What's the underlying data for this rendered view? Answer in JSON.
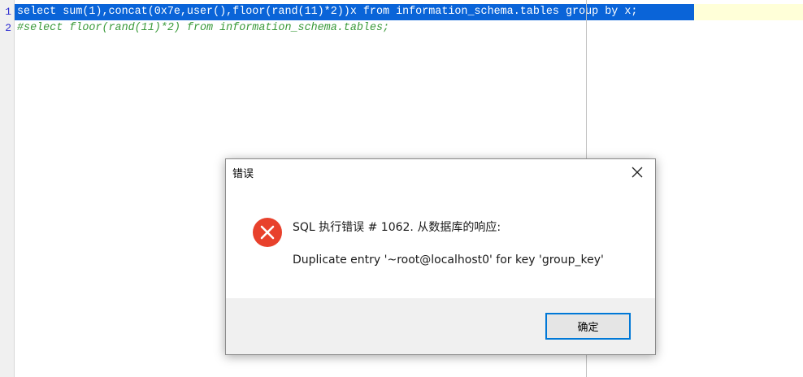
{
  "editor": {
    "line_numbers": [
      "1",
      "2"
    ],
    "lines": [
      "select sum(1),concat(0x7e,user(),floor(rand(11)*2))x from information_schema.tables group by x;",
      "#select floor(rand(11)*2) from information_schema.tables;"
    ]
  },
  "dialog": {
    "title": "错误",
    "close_icon": "close-icon",
    "error_icon": "error-x-icon",
    "message_header": "SQL 执行错误 # 1062. 从数据库的响应:",
    "message_detail": "Duplicate entry '~root@localhost0' for key 'group_key'",
    "ok_label": "确定"
  },
  "colors": {
    "selection": "#0a64d8",
    "current_line": "#ffffd8",
    "comment": "#3a9a3a",
    "line_number": "#2b2bd0",
    "error_icon": "#e8412c",
    "button_focus": "#0078d7"
  }
}
